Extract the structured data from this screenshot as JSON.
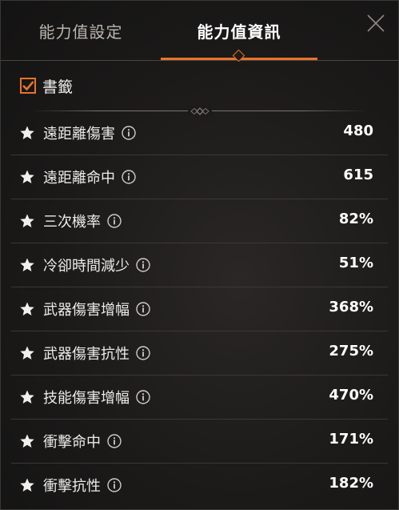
{
  "tabs": [
    {
      "label": "能力值設定",
      "active": false
    },
    {
      "label": "能力值資訊",
      "active": true
    }
  ],
  "bookmark": {
    "label": "書籤",
    "checked": true
  },
  "accent_color": "#e8732c",
  "stats": [
    {
      "name": "遠距離傷害",
      "value": "480"
    },
    {
      "name": "遠距離命中",
      "value": "615"
    },
    {
      "name": "三次機率",
      "value": "82%"
    },
    {
      "name": "冷卻時間減少",
      "value": "51%"
    },
    {
      "name": "武器傷害增幅",
      "value": "368%"
    },
    {
      "name": "武器傷害抗性",
      "value": "275%"
    },
    {
      "name": "技能傷害增幅",
      "value": "470%"
    },
    {
      "name": "衝擊命中",
      "value": "171%"
    },
    {
      "name": "衝擊抗性",
      "value": "182%"
    }
  ]
}
